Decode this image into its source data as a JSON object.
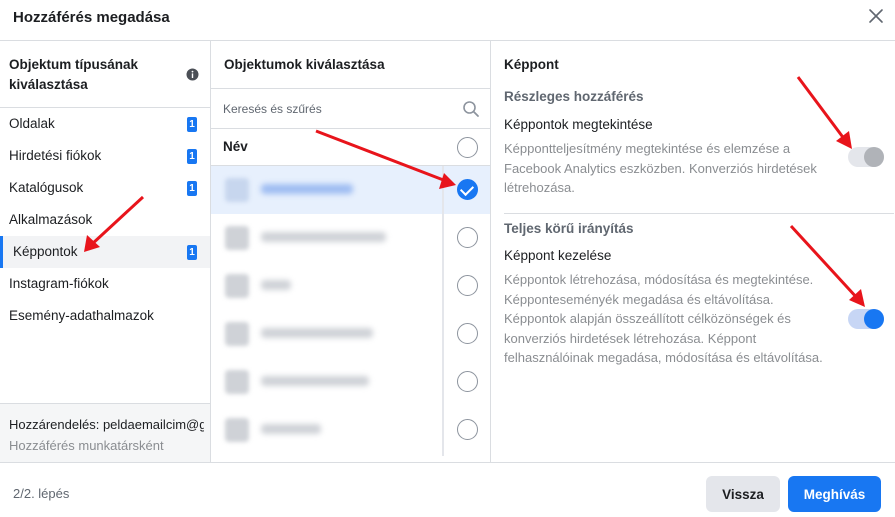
{
  "dialog": {
    "title": "Hozzáférés megadása"
  },
  "object_types": {
    "heading": "Objektum típusának kiválasztása",
    "items": [
      {
        "label": "Oldalak",
        "badge": "1"
      },
      {
        "label": "Hirdetési fiókok",
        "badge": "1"
      },
      {
        "label": "Katalógusok",
        "badge": "1"
      },
      {
        "label": "Alkalmazások",
        "badge": ""
      },
      {
        "label": "Képpontok",
        "badge": "1"
      },
      {
        "label": "Instagram-fiókok",
        "badge": ""
      },
      {
        "label": "Esemény-adathalmazok",
        "badge": ""
      }
    ],
    "selected_index": 4,
    "assignment": "Hozzárendelés: peldaemailcim@gmail.com",
    "assignment_role": "Hozzáférés munkatársként"
  },
  "objects": {
    "heading": "Objektumok kiválasztása",
    "search_placeholder": "Keresés és szűrés",
    "name_header": "Név",
    "selected_index": 0
  },
  "permissions": {
    "heading": "Képpont",
    "partial": {
      "section": "Részleges hozzáférés",
      "title": "Képpontok megtekintése",
      "desc": "Képpontteljesítmény megtekintése és elemzése a Facebook Analytics eszközben. Konverziós hirdetések létrehozása.",
      "enabled": false
    },
    "full": {
      "section": "Teljes körű irányítás",
      "title": "Képpont kezelése",
      "desc": "Képpontok létrehozása, módosítása és megtekintése. Képponteseményék megadása és eltávolítása. Képpontok alapján összeállított célközönségek és konverziós hirdetések létrehozása. Képpont felhasználóinak megadása, módosítása és eltávolítása.",
      "enabled": true
    }
  },
  "footer": {
    "step": "2/2. lépés",
    "back_label": "Vissza",
    "invite_label": "Meghívás"
  },
  "colors": {
    "accent": "#1877f2",
    "arrow": "#e8141b"
  }
}
